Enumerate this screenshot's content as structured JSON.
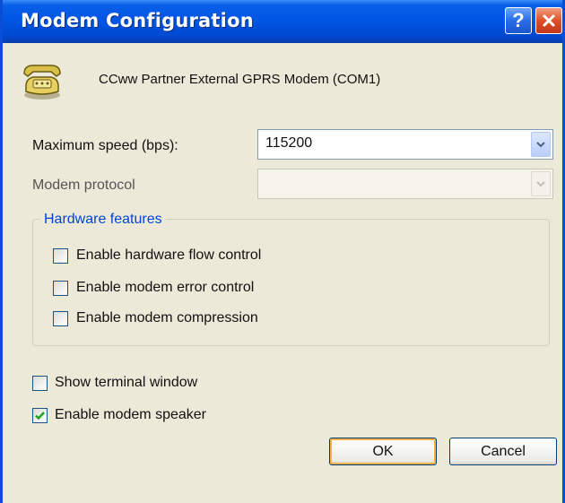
{
  "window": {
    "title": "Modem Configuration"
  },
  "device": {
    "name": "CCww Partner External GPRS Modem (COM1)",
    "icon": "telephone-modem-icon"
  },
  "max_speed": {
    "label": "Maximum speed (bps):",
    "value": "115200"
  },
  "protocol": {
    "label": "Modem protocol",
    "value": ""
  },
  "hardware": {
    "title": "Hardware features",
    "items": [
      {
        "label": "Enable hardware flow control",
        "checked": false
      },
      {
        "label": "Enable modem error control",
        "checked": false
      },
      {
        "label": "Enable modem compression",
        "checked": false
      }
    ]
  },
  "options": [
    {
      "label": "Show terminal window",
      "checked": false
    },
    {
      "label": "Enable modem speaker",
      "checked": true
    }
  ],
  "buttons": {
    "ok": "OK",
    "cancel": "Cancel"
  },
  "colors": {
    "titlebar": "#0054e3",
    "group_title": "#0046d5",
    "check_mark": "#21a121"
  }
}
